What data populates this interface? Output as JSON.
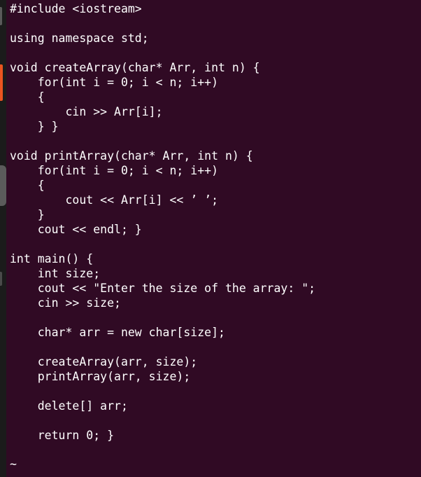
{
  "terminal": {
    "background": "#300a24",
    "foreground": "#ffffff",
    "lines": [
      "#include <iostream>",
      "",
      "using namespace std;",
      "",
      "void createArray(char* Arr, int n) {",
      "    for(int i = 0; i < n; i++)",
      "    {",
      "        cin >> Arr[i];",
      "    } }",
      "",
      "void printArray(char* Arr, int n) {",
      "    for(int i = 0; i < n; i++)",
      "    {",
      "        cout << Arr[i] << ’ ’;",
      "    }",
      "    cout << endl; }",
      "",
      "int main() {",
      "    int size;",
      "    cout << \"Enter the size of the array: \";",
      "    cin >> size;",
      "",
      "    char* arr = new char[size];",
      "",
      "    createArray(arr, size);",
      "    printArray(arr, size);",
      "",
      "    delete[] arr;",
      "",
      "    return 0; }"
    ],
    "empty_line_marker": "~"
  },
  "dock": {
    "accent_color": "#e95420"
  }
}
